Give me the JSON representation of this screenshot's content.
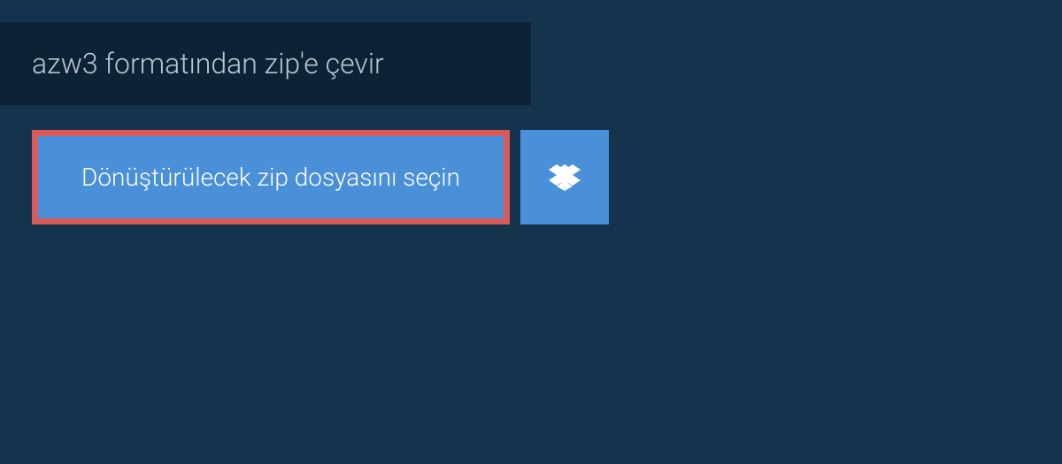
{
  "title": "azw3 formatından zip'e çevir",
  "buttons": {
    "file_select": "Dönüştürülecek zip dosyasını seçin"
  },
  "colors": {
    "background": "#15334d",
    "title_bg": "#0d2236",
    "button_bg": "#4a90d9",
    "button_border": "#d85a5a",
    "text_light": "#b8c7d4",
    "text_white": "#ffffff"
  }
}
